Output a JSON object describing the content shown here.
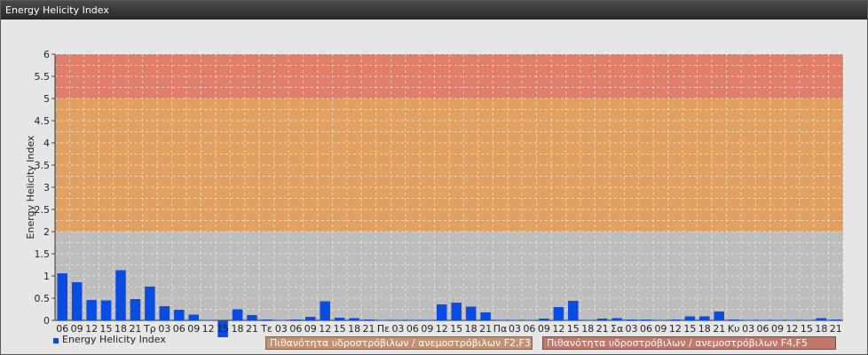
{
  "window": {
    "title": "Energy Helicity Index"
  },
  "chart_data": {
    "type": "bar",
    "ylabel": "Energy Helicity Index",
    "ylim": [
      0,
      6
    ],
    "yticks": [
      "0",
      "0.5",
      "1",
      "1.5",
      "2",
      "2.5",
      "3",
      "3.5",
      "4",
      "4.5",
      "5",
      "5.5",
      "6"
    ],
    "categories": [
      "06",
      "09",
      "12",
      "15",
      "18",
      "21",
      "Τρ",
      "03",
      "06",
      "09",
      "12",
      "15",
      "18",
      "21",
      "Τε",
      "03",
      "06",
      "09",
      "12",
      "15",
      "18",
      "21",
      "Πε",
      "03",
      "06",
      "09",
      "12",
      "15",
      "18",
      "21",
      "Πα",
      "03",
      "06",
      "09",
      "12",
      "15",
      "18",
      "21",
      "Σα",
      "03",
      "06",
      "09",
      "12",
      "15",
      "18",
      "21",
      "Κυ",
      "03",
      "06",
      "09",
      "12",
      "15",
      "18",
      "21"
    ],
    "series": [
      {
        "name": "Energy Helicity Index",
        "color": "#0a4be0",
        "values": [
          1.06,
          0.86,
          0.46,
          0.45,
          1.13,
          0.48,
          0.76,
          0.32,
          0.24,
          0.13,
          0.01,
          -0.38,
          0.25,
          0.12,
          0.02,
          0.01,
          0.02,
          0.08,
          0.43,
          0.06,
          0.05,
          0.02,
          0.01,
          0.01,
          0.01,
          0.01,
          0.36,
          0.4,
          0.31,
          0.18,
          0.01,
          0.01,
          0.01,
          0.04,
          0.3,
          0.44,
          0.01,
          0.04,
          0.05,
          0.02,
          0.02,
          0.01,
          0.02,
          0.09,
          0.09,
          0.2,
          0.02,
          0.01,
          0.01,
          0.01,
          0.01,
          0.01,
          0.05,
          0.02
        ]
      }
    ],
    "bands": [
      {
        "from": 2,
        "to": 5,
        "color": "#e2a060",
        "label": "Πιθανότητα υδροστρόβιλων / ανεμοστρόβιλων F2,F3"
      },
      {
        "from": 5,
        "to": 6,
        "color": "#e07e6a",
        "label": "Πιθανότητα υδροστρόβιλων / ανεμοστρόβιλων F4,F5"
      }
    ],
    "lower_band_color": "#bdbdbd",
    "grid": true,
    "legend": "bottom-left"
  }
}
